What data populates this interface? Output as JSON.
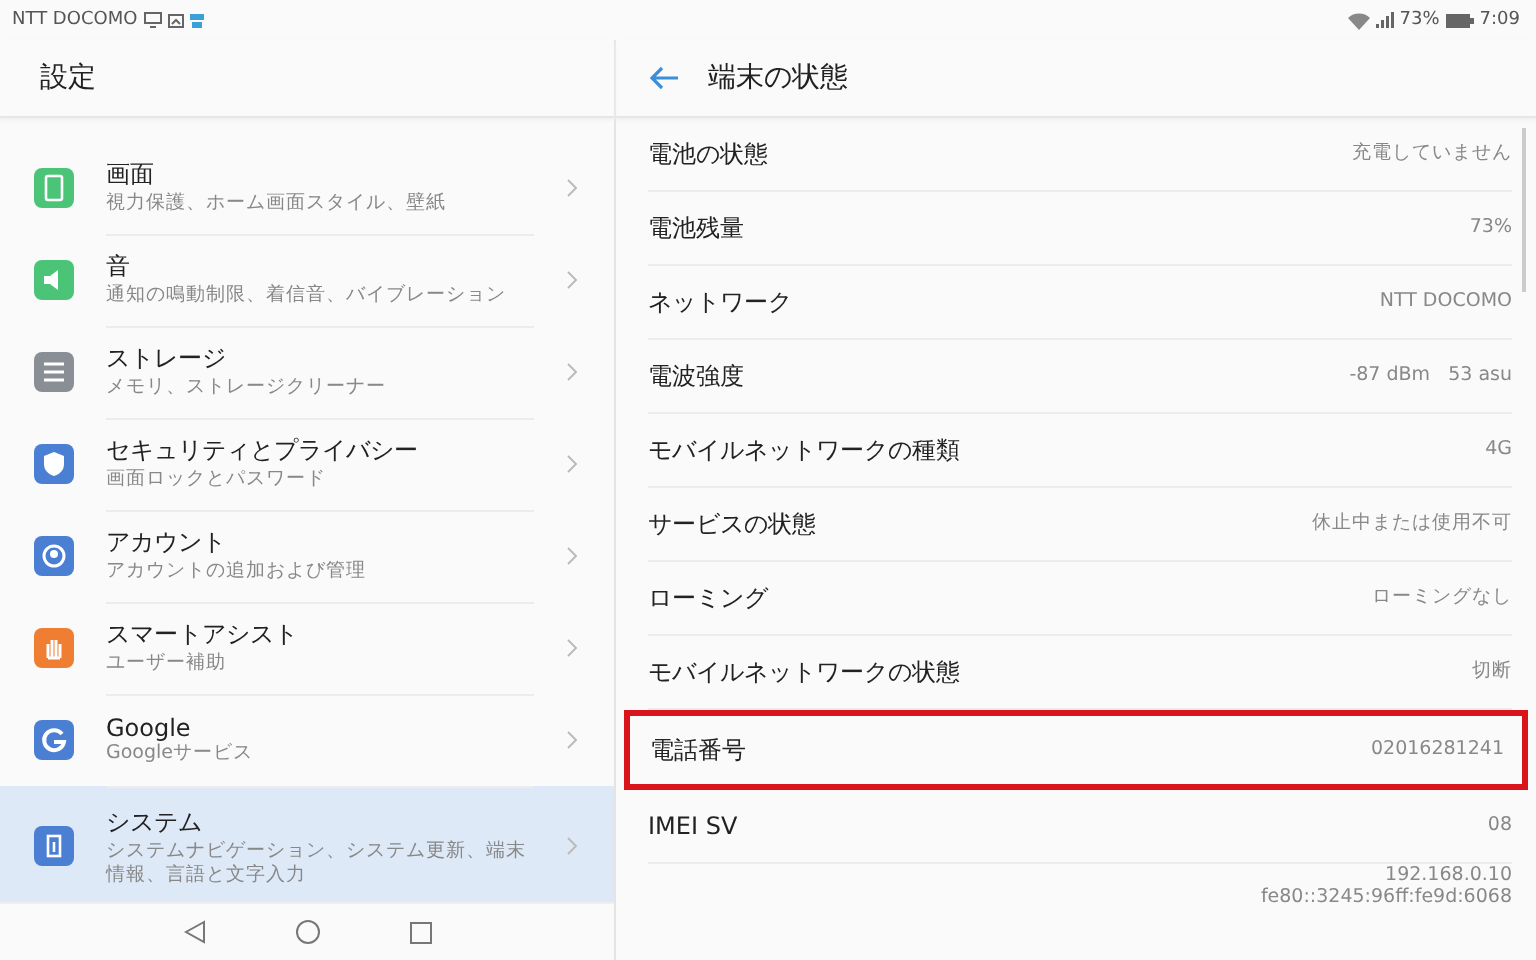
{
  "status_bar": {
    "carrier": "NTT DOCOMO",
    "battery_text": "73%",
    "time": "7:09"
  },
  "settings": {
    "title": "設定",
    "items": [
      {
        "title": "画面",
        "subtitle": "視力保護、ホーム画面スタイル、壁紙",
        "color": "#4cc478",
        "selected": false
      },
      {
        "title": "音",
        "subtitle": "通知の鳴動制限、着信音、バイブレーション",
        "color": "#4cc478",
        "selected": false
      },
      {
        "title": "ストレージ",
        "subtitle": "メモリ、ストレージクリーナー",
        "color": "#8a8f96",
        "selected": false
      },
      {
        "title": "セキュリティとプライバシー",
        "subtitle": "画面ロックとパスワード",
        "color": "#4a7fd4",
        "selected": false
      },
      {
        "title": "アカウント",
        "subtitle": "アカウントの追加および管理",
        "color": "#4a7fd4",
        "selected": false
      },
      {
        "title": "スマートアシスト",
        "subtitle": "ユーザー補助",
        "color": "#ef7d32",
        "selected": false
      },
      {
        "title": "Google",
        "subtitle": "Googleサービス",
        "color": "#4a7fd4",
        "selected": false
      },
      {
        "title": "システム",
        "subtitle": "システムナビゲーション、システム更新、端末情報、言語と文字入力",
        "color": "#4a7fd4",
        "selected": true
      }
    ]
  },
  "status": {
    "title": "端末の状態",
    "rows": [
      {
        "label": "電池の状態",
        "value": "充電していません",
        "highlighted": false
      },
      {
        "label": "電池残量",
        "value": "73%",
        "highlighted": false
      },
      {
        "label": "ネットワーク",
        "value": "NTT DOCOMO",
        "highlighted": false
      },
      {
        "label": "電波強度",
        "value": "-87 dBm   53 asu",
        "highlighted": false
      },
      {
        "label": "モバイルネットワークの種類",
        "value": "4G",
        "highlighted": false
      },
      {
        "label": "サービスの状態",
        "value": "休止中または使用不可",
        "highlighted": false
      },
      {
        "label": "ローミング",
        "value": "ローミングなし",
        "highlighted": false
      },
      {
        "label": "モバイルネットワークの状態",
        "value": "切断",
        "highlighted": false
      },
      {
        "label": "電話番号",
        "value": "02016281241",
        "highlighted": true
      },
      {
        "label": "IMEI SV",
        "value": "08",
        "highlighted": false
      },
      {
        "value": "192.168.0.10\nfe80::3245:96ff:fe9d:6068",
        "highlighted": false
      }
    ]
  }
}
